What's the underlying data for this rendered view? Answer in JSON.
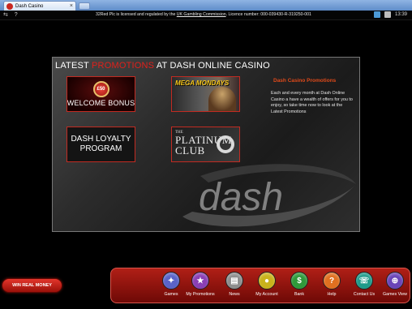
{
  "browser": {
    "tab_title": "Dash Casino",
    "tab_close": "×"
  },
  "topbar": {
    "icons": "⇆ ?",
    "licence_prefix": "32Red Plc is licensed and regulated by the ",
    "licence_link": "UK Gambling Commission",
    "licence_suffix": ". Licence number: 000-039430-R-319250-001",
    "clock": "13:39"
  },
  "panel": {
    "title_part1": "LATEST ",
    "title_highlight": "PROMOTIONS",
    "title_part2": " AT DASH ONLINE CASINO",
    "promos": {
      "welcome_chip": "£50",
      "welcome_label": "WELCOME BONUS",
      "mega_label": "MEGA MONDAYS",
      "loyalty_line1": "DASH LOYALTY",
      "loyalty_line2": "PROGRAM",
      "platinum_small": "THE",
      "platinum_line1": "PLATINUM",
      "platinum_line2": "CLUB"
    },
    "side_title": "Dash Casino Promotions",
    "side_body": "Each and every month at Dash Online Casino a have a wealth of offers for you to enjoy, so take time now to look at the Latest Promotions"
  },
  "win_button": "WIN REAL MONEY",
  "nav": {
    "items": [
      {
        "label": "Games",
        "glyph": "✦",
        "color": "#5a63c8"
      },
      {
        "label": "My Promotions",
        "glyph": "★",
        "color": "#8a3fb4"
      },
      {
        "label": "News",
        "glyph": "▤",
        "color": "#8e8e8e"
      },
      {
        "label": "My Account",
        "glyph": "●",
        "color": "#c9b21c"
      },
      {
        "label": "Bank",
        "glyph": "$",
        "color": "#2f9a3a"
      },
      {
        "label": "Help",
        "glyph": "?",
        "color": "#e07020"
      },
      {
        "label": "Contact Us",
        "glyph": "☏",
        "color": "#1f9b8a"
      },
      {
        "label": "Games View",
        "glyph": "⊕",
        "color": "#6a45b8"
      }
    ]
  },
  "colors": {
    "accent_red": "#c8261f",
    "promo_title_red": "#e0201b",
    "side_title_orange": "#e04a1a"
  }
}
